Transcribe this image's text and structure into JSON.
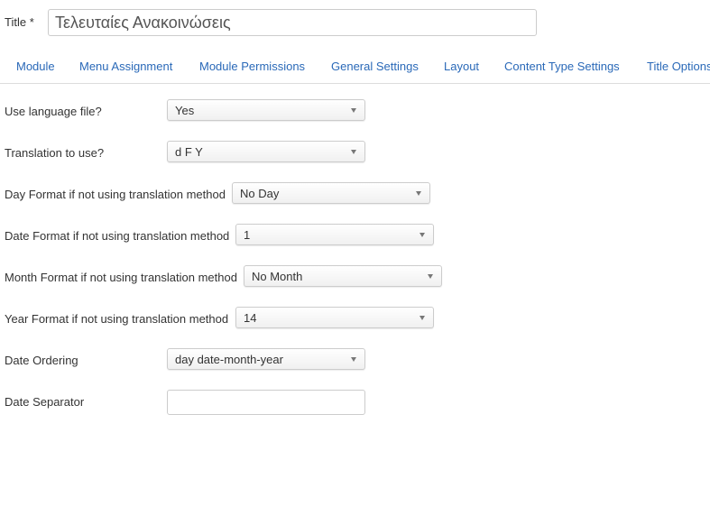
{
  "title_field": {
    "label": "Title *",
    "value": "Τελευταίες Ανακοινώσεις"
  },
  "tabs": [
    {
      "label": "Module"
    },
    {
      "label": "Menu Assignment"
    },
    {
      "label": "Module Permissions"
    },
    {
      "label": "General Settings"
    },
    {
      "label": "Layout"
    },
    {
      "label": "Content Type Settings"
    },
    {
      "label": "Title Options"
    }
  ],
  "fields": [
    {
      "label": "Use language file?",
      "value": "Yes"
    },
    {
      "label": "Translation to use?",
      "value": "d F Y"
    },
    {
      "label": "Day Format if not using translation method",
      "value": "No Day"
    },
    {
      "label": "Date Format if not using translation method",
      "value": "1"
    },
    {
      "label": "Month Format if not using translation method",
      "value": "No Month"
    },
    {
      "label": "Year Format if not using translation method",
      "value": "14"
    },
    {
      "label": "Date Ordering",
      "value": "day date-month-year"
    },
    {
      "label": "Date Separator",
      "value": ""
    }
  ],
  "colors": {
    "tab_link": "#2a69b8",
    "text": "#333333",
    "border": "#cccccc"
  },
  "icons": {
    "select_arrow": "triangle-down-icon"
  }
}
